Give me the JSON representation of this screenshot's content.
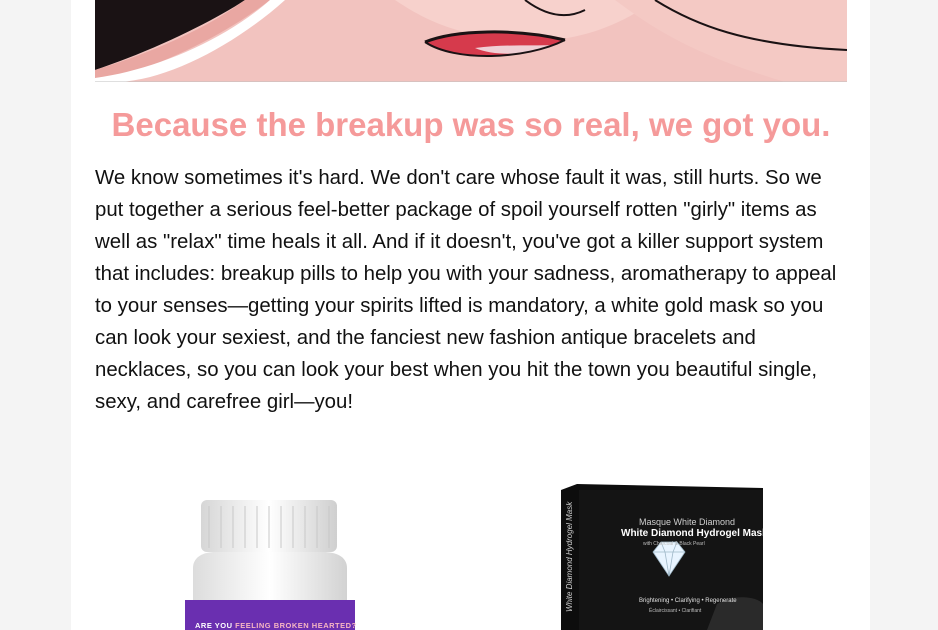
{
  "email": {
    "headline": "Because the breakup was so real, we got you.",
    "body": "We know sometimes it's hard. We don't care whose fault it was, still hurts. So we put together a serious feel-better package of spoil yourself rotten \"girly\" items as well as \"relax\" time heals it all. And if it doesn't, you've got a killer support system that includes: breakup pills to help you with your sadness, aromatherapy to appeal to your senses—getting your spirits lifted is mandatory, a white gold mask so you can look your sexiest, and the fanciest new fashion antique bracelets and necklaces, so you can look your best when you hit the town you beautiful single, sexy, and carefree girl—you!"
  },
  "products": {
    "pills": {
      "label_lead": "ARE YOU ",
      "label_accent": "FEELING BROKEN HEARTED?"
    },
    "mask": {
      "brand": "Masque White Diamond",
      "title": "White Diamond Hydrogel Mask",
      "subtitle": "with Charcoal & Black Pearl",
      "benefits": "Brightening • Clarifying • Regenerate",
      "benefits_fr": "Éclaircissant • Clarifiant",
      "side_text": "White Diamond Hydrogel Mask"
    }
  },
  "colors": {
    "headline": "#f59a9a",
    "body_text": "#111111",
    "page_bg": "#f4f4f4",
    "card_bg": "#ffffff",
    "pill_label": "#6a2fb0",
    "mask_box": "#111111"
  },
  "icons": {
    "hero": "illustrated-lips-image",
    "pills": "pill-bottle-image",
    "mask": "diamond-mask-box-image"
  }
}
